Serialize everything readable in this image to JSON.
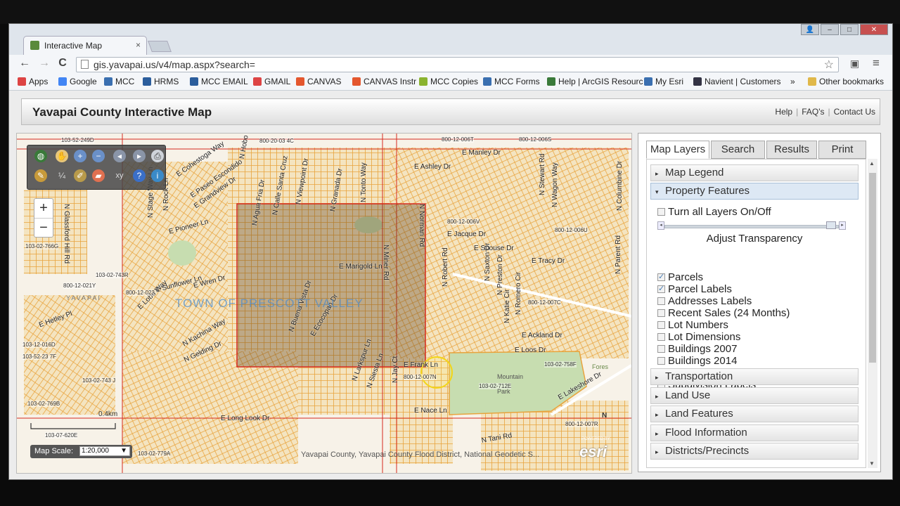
{
  "browser": {
    "tab_title": "Interactive Map",
    "tab_close": "×",
    "window_controls": {
      "user": "👤",
      "minimize": "–",
      "maximize": "□",
      "close": "✕"
    },
    "url": "gis.yavapai.us/v4/map.aspx?search=",
    "nav": {
      "back": "←",
      "forward": "→",
      "reload": "C"
    },
    "star_icon": "☆",
    "menu_icon": "≡",
    "bookmarks": [
      {
        "label": "Apps",
        "icon": "apps-icon",
        "color": "#d44"
      },
      {
        "label": "Google",
        "icon": "google-icon",
        "color": "#4285f4"
      },
      {
        "label": "MCC",
        "icon": "page-icon",
        "color": "#3a6fb0"
      },
      {
        "label": "HRMS",
        "icon": "page-icon",
        "color": "#2b5d9c"
      },
      {
        "label": "MCC EMAIL",
        "icon": "page-icon",
        "color": "#2b5d9c"
      },
      {
        "label": "GMAIL",
        "icon": "gmail-icon",
        "color": "#d44"
      },
      {
        "label": "CANVAS",
        "icon": "canvas-icon",
        "color": "#e4572e"
      },
      {
        "label": "CANVAS Instr",
        "icon": "canvas-icon",
        "color": "#e4572e"
      },
      {
        "label": "MCC Copies",
        "icon": "page-icon",
        "color": "#8ab32f"
      },
      {
        "label": "MCC Forms",
        "icon": "page-icon",
        "color": "#3a6fb0"
      },
      {
        "label": "Help | ArcGIS Resourc",
        "icon": "globe-icon",
        "color": "#3a7a3a"
      },
      {
        "label": "My Esri",
        "icon": "page-icon",
        "color": "#3a6fb0"
      },
      {
        "label": "Navient | Customers",
        "icon": "page-icon",
        "color": "#334"
      },
      {
        "label": "»",
        "icon": "",
        "color": ""
      },
      {
        "label": "Other bookmarks",
        "icon": "folder-icon",
        "color": "#e0b84a"
      }
    ]
  },
  "header": {
    "title": "Yavapai County Interactive Map",
    "links": [
      "Help",
      "FAQ's",
      "Contact Us"
    ],
    "sep": "|"
  },
  "map": {
    "town_label": "TOWN OF PRESCOTT VALLEY",
    "county_label": "YAVAPAI",
    "streets": [
      "E Manley Dr",
      "E Ashley Dr",
      "E Jacque Dr",
      "E Spouse Dr",
      "E Tracy Dr",
      "E Marigold Ln",
      "E Sunflower Ln",
      "E Wren Dr",
      "E Pioneer Ln",
      "E Lobo Way",
      "E Hetley Pl",
      "N Kachina Way",
      "N Gelding Dr",
      "E Ackland Dr",
      "E Loos Dr",
      "E Frank Ln",
      "E Nace Ln",
      "E Long Look Dr",
      "E Lakeshore Dr",
      "N Tani Rd",
      "N Glassford Hill Rd",
      "N Stage Way Ln",
      "N Rock Ln",
      "N Hobo Cir",
      "N Agua Fria Dr",
      "N Calle Santa Cruz",
      "N Viewpoint Dr",
      "N Granada Dr",
      "N Tonto Way",
      "N Miner Rd",
      "N Norman Rd",
      "N Robert Rd",
      "N Saxton Dr",
      "N Preston Dr",
      "N Katie Cir",
      "N Romero Cir",
      "E Cohestoga Way",
      "E Paseo Escondido",
      "E Grandview Dr",
      "N Buena Vista Dr",
      "E Ecocopan Dr",
      "N Larkspur Ln",
      "N Siesta Ln",
      "N Jay Ct",
      "N Stewart Rd",
      "N Wagon Way",
      "N Columbine Dr",
      "N Parent Rd"
    ],
    "parcels": [
      "103-52-249D",
      "800-20-03 4C",
      "800-12-006T",
      "800-12-006S",
      "800-12-006V",
      "800-12-006U",
      "800-12-007C",
      "103-02-743R",
      "800-12-021Y",
      "800-12-023",
      "103-12-016D",
      "103-52-23 7F",
      "103-02-743 J",
      "103-02-769B",
      "103-07-620E",
      "103-02-758F",
      "103-02-712E",
      "800-12-007R",
      "103-02-779A",
      "103-02-766G",
      "800-12-007N"
    ],
    "park_label": "Mountain",
    "park_sub": "Park",
    "forest_label": "Fores",
    "scale_bar": "0.4km",
    "attribution": "Yavapai County, Yavapai County Flood District, National Geodetic S...",
    "esri": "esri",
    "powered_by": "POWERED BY",
    "north": "N",
    "zoom_in": "+",
    "zoom_out": "−",
    "scale_label": "Map Scale:",
    "scale_value": "1:20,000",
    "scale_arrow": "▼"
  },
  "sidebar": {
    "tabs": [
      "Map Layers",
      "Search",
      "Results",
      "Print"
    ],
    "sections_top": [
      {
        "label": "Map Legend",
        "arrow": "▸"
      },
      {
        "label": "Property Features",
        "arrow": "▾"
      }
    ],
    "toggle_all": "Turn all Layers On/Off",
    "adjust_transparency": "Adjust Transparency",
    "layers": [
      {
        "label": "Parcels",
        "checked": true
      },
      {
        "label": "Parcel Labels",
        "checked": true
      },
      {
        "label": "Addresses Labels",
        "checked": false
      },
      {
        "label": "Recent Sales (24 Months)",
        "checked": false
      },
      {
        "label": "Lot Numbers",
        "checked": false
      },
      {
        "label": "Lot Dimensions",
        "checked": false
      },
      {
        "label": "Buildings 2007",
        "checked": false
      },
      {
        "label": "Buildings 2014",
        "checked": false
      },
      {
        "label": "Subdivisions",
        "checked": false
      },
      {
        "label": "Subdivision Labels",
        "checked": false
      }
    ],
    "sections_bottom": [
      {
        "label": "Transportation",
        "arrow": "▸"
      },
      {
        "label": "Land Use",
        "arrow": "▸"
      },
      {
        "label": "Land Features",
        "arrow": "▸"
      },
      {
        "label": "Flood Information",
        "arrow": "▸"
      },
      {
        "label": "Districts/Precincts",
        "arrow": "▸"
      }
    ],
    "scroll_up": "▲",
    "scroll_down": "▼"
  },
  "colors": {
    "parcel_lines": "#e8a33c",
    "selection_box": "#d62b1f",
    "park": "#c7ddb0",
    "accent": "#4a7fb5"
  }
}
